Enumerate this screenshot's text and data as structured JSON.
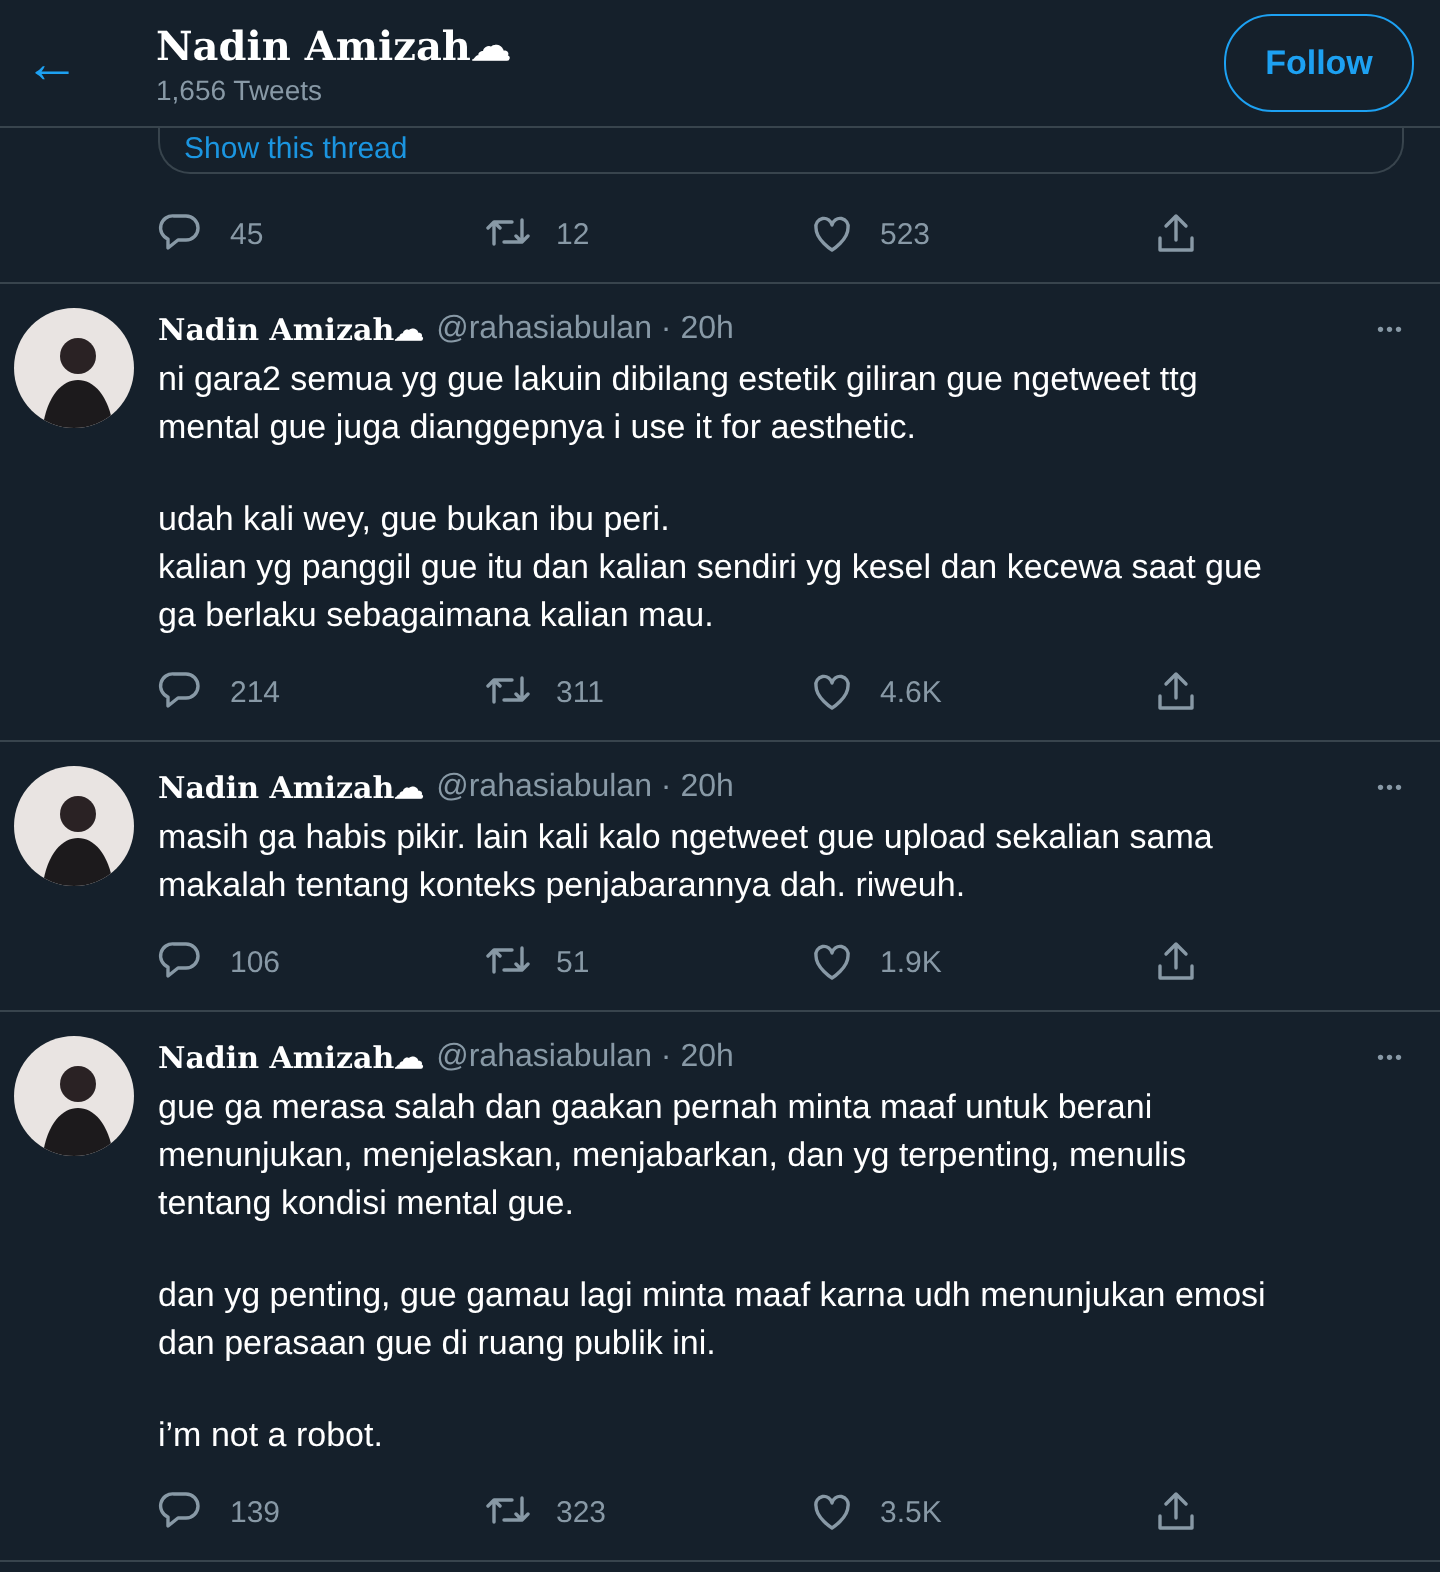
{
  "header": {
    "back": "←",
    "name": "Nadin Amizah☁",
    "tweet_count": "1,656 Tweets",
    "follow": "Follow"
  },
  "top_tweet": {
    "thread_link": "Show this thread",
    "replies": "45",
    "retweets": "12",
    "likes": "523"
  },
  "tweets": [
    {
      "name": "Nadin Amizah☁",
      "handle": "@rahasiabulan",
      "separator": "·",
      "time": "20h",
      "more": "•••",
      "paragraphs": [
        "ni gara2 semua yg gue lakuin dibilang estetik giliran gue ngetweet ttg mental gue juga dianggepnya i use it for aesthetic.",
        "udah kali wey, gue bukan ibu peri.\nkalian yg panggil gue itu dan kalian sendiri yg kesel dan kecewa saat gue ga berlaku sebagaimana kalian mau."
      ],
      "replies": "214",
      "retweets": "311",
      "likes": "4.6K"
    },
    {
      "name": "Nadin Amizah☁",
      "handle": "@rahasiabulan",
      "separator": "·",
      "time": "20h",
      "more": "•••",
      "paragraphs": [
        "masih ga habis pikir. lain kali kalo ngetweet gue upload sekalian sama makalah tentang konteks penjabarannya dah. riweuh."
      ],
      "replies": "106",
      "retweets": "51",
      "likes": "1.9K"
    },
    {
      "name": "Nadin Amizah☁",
      "handle": "@rahasiabulan",
      "separator": "·",
      "time": "20h",
      "more": "•••",
      "paragraphs": [
        "gue ga merasa salah dan gaakan pernah minta maaf untuk berani menunjukan, menjelaskan, menjabarkan, dan yg terpenting, menulis tentang kondisi mental gue.",
        "dan yg penting, gue gamau lagi minta maaf karna udh menunjukan emosi dan perasaan gue di ruang publik ini.",
        "i’m not a robot."
      ],
      "replies": "139",
      "retweets": "323",
      "likes": "3.5K"
    }
  ]
}
